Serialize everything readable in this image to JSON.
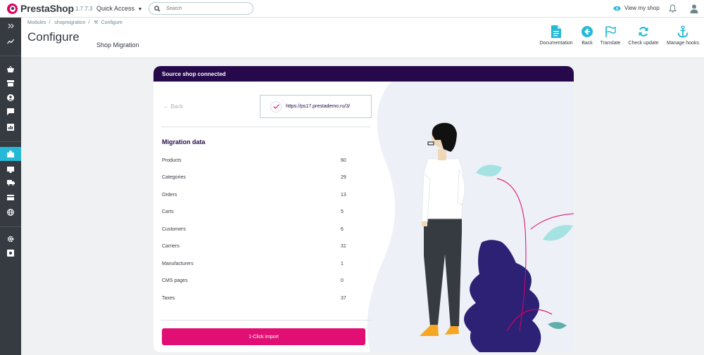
{
  "topbar": {
    "brand": "PrestaShop",
    "version": "1.7.7.3",
    "quick_access": "Quick Access",
    "search_placeholder": "Search",
    "view_shop": "View my shop"
  },
  "breadcrumb": [
    "Modules",
    "shopmigration",
    "Configure"
  ],
  "page_title": "Configure",
  "subtitle": "Shop Migration",
  "toolbar": {
    "documentation": "Documentation",
    "back": "Back",
    "translate": "Translate",
    "check_update": "Check update",
    "manage_hooks": "Manage hooks"
  },
  "sidebar": {
    "icons": [
      "collapse-icon",
      "dashboard-icon",
      "orders-icon",
      "catalog-icon",
      "customers-icon",
      "messages-icon",
      "stats-icon",
      "modules-icon",
      "design-icon",
      "shipping-icon",
      "payment-icon",
      "international-icon",
      "settings-icon",
      "advanced-icon"
    ],
    "active": "modules-icon"
  },
  "card": {
    "header": "Source shop connected",
    "back": "← Back",
    "url": "https://ps17.prestademo.ru/3/",
    "section_title": "Migration data",
    "rows": [
      {
        "label": "Products",
        "value": "60"
      },
      {
        "label": "Categories",
        "value": "29"
      },
      {
        "label": "Orders",
        "value": "13"
      },
      {
        "label": "Carts",
        "value": "5"
      },
      {
        "label": "Customers",
        "value": "6"
      },
      {
        "label": "Carriers",
        "value": "31"
      },
      {
        "label": "Manufacturers",
        "value": "1"
      },
      {
        "label": "CMS pages",
        "value": "0"
      },
      {
        "label": "Taxes",
        "value": "37"
      }
    ],
    "import_button": "1-Click import"
  },
  "colors": {
    "accent": "#25b9d7",
    "header_bar": "#25094a",
    "import_button": "#e10f74"
  }
}
